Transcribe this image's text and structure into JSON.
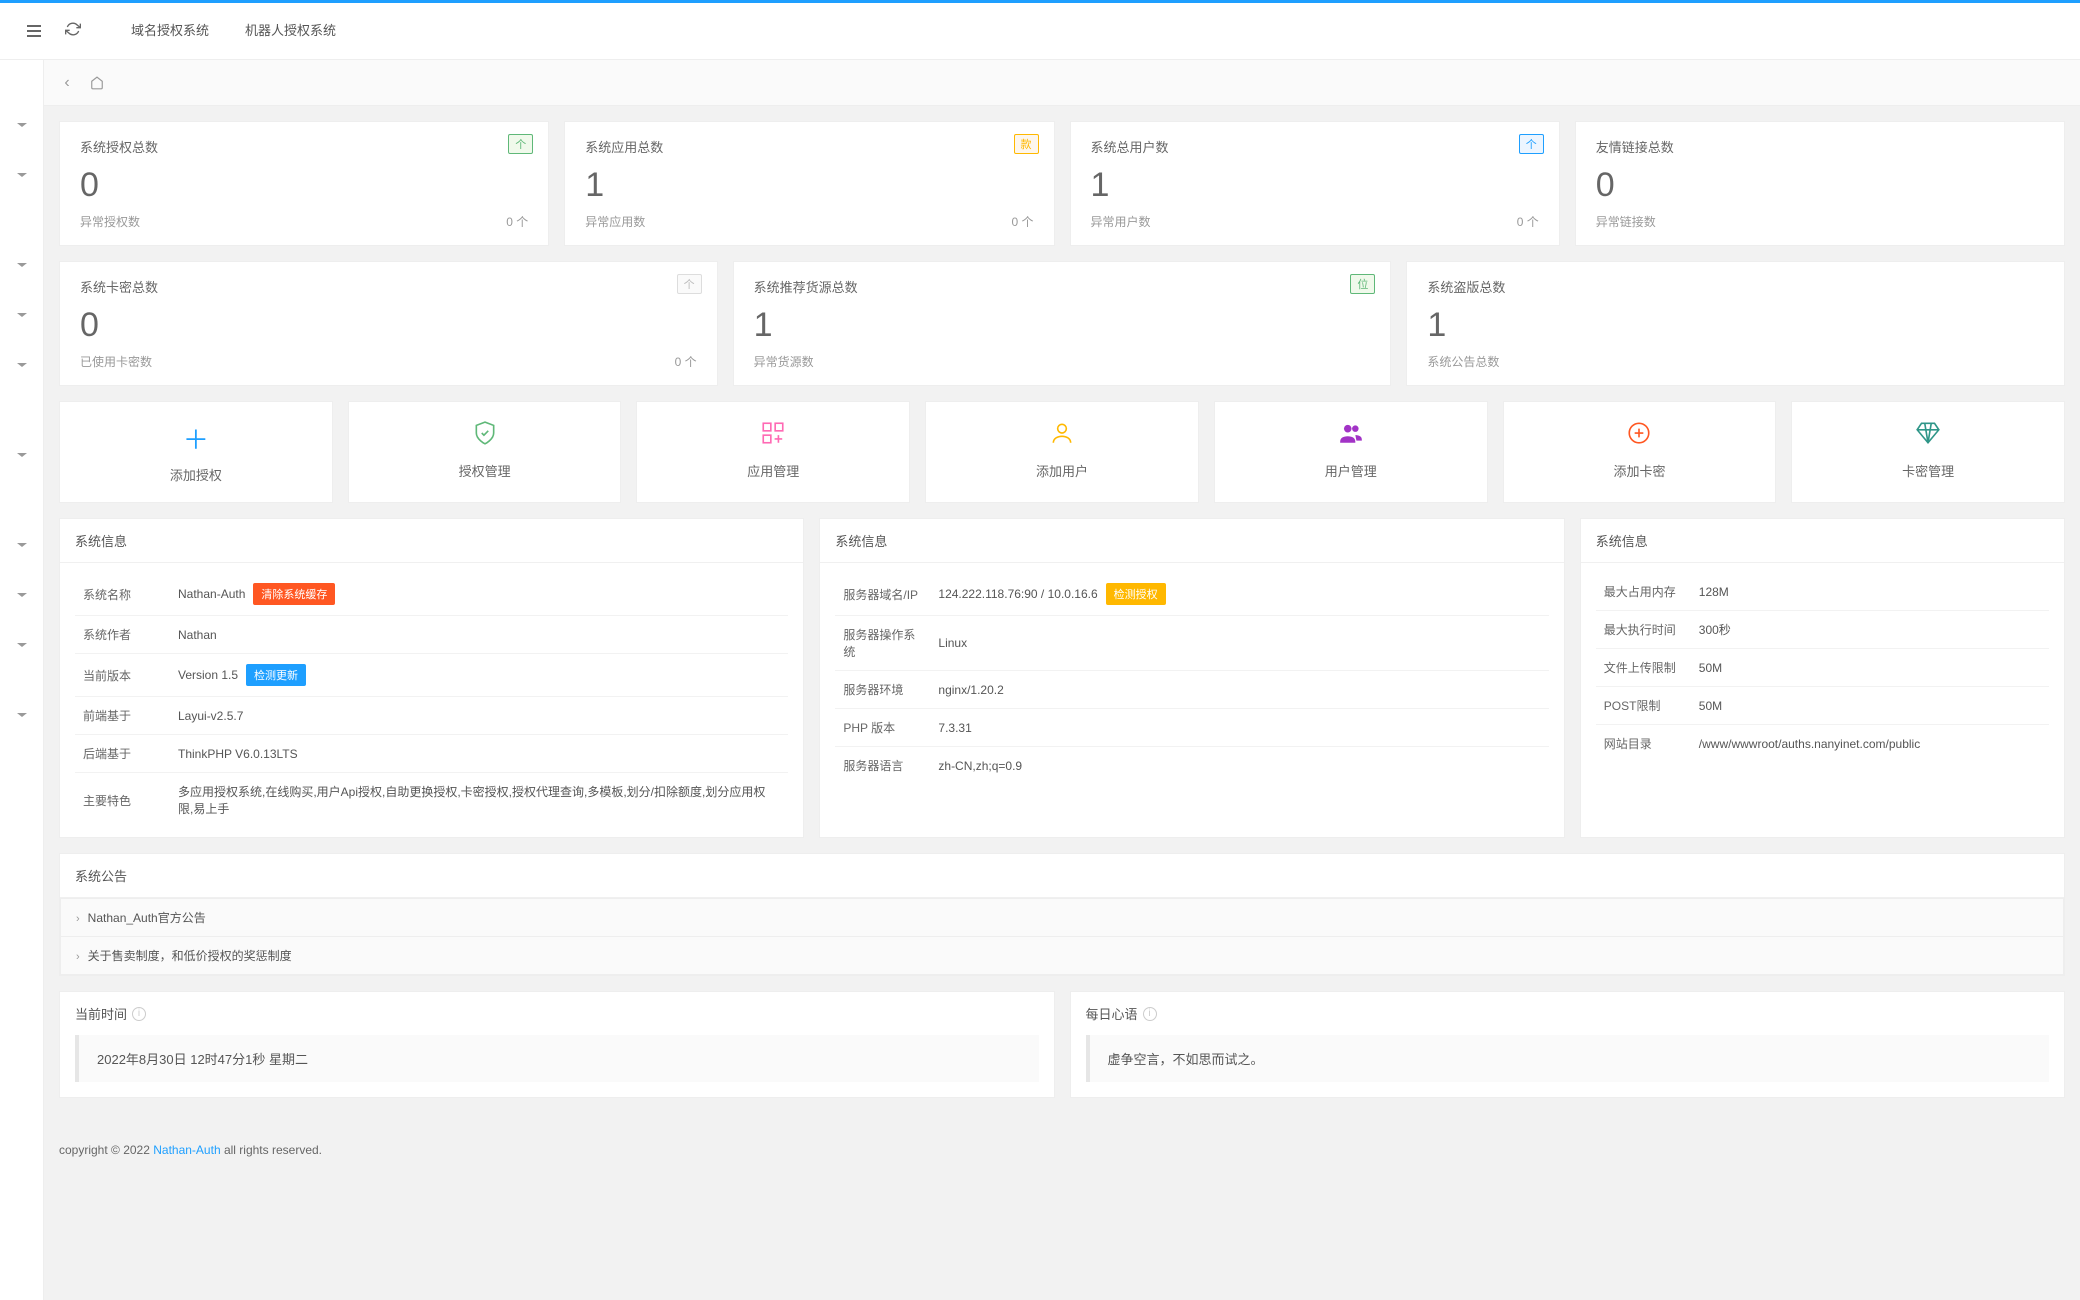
{
  "topbar": {
    "tabs": [
      "域名授权系统",
      "机器人授权系统"
    ]
  },
  "stats_row1": [
    {
      "title": "系统授权总数",
      "value": "0",
      "footer_label": "异常授权数",
      "footer_value": "0 个",
      "badge": "个",
      "badge_class": "badge-green"
    },
    {
      "title": "系统应用总数",
      "value": "1",
      "footer_label": "异常应用数",
      "footer_value": "0 个",
      "badge": "款",
      "badge_class": "badge-orange"
    },
    {
      "title": "系统总用户数",
      "value": "1",
      "footer_label": "异常用户数",
      "footer_value": "0 个",
      "badge": "个",
      "badge_class": "badge-blue"
    },
    {
      "title": "友情链接总数",
      "value": "0",
      "footer_label": "异常链接数",
      "footer_value": "",
      "badge": "",
      "badge_class": ""
    }
  ],
  "stats_row2": [
    {
      "title": "系统卡密总数",
      "value": "0",
      "footer_label": "已使用卡密数",
      "footer_value": "0 个",
      "badge": "个",
      "badge_class": "badge-gray"
    },
    {
      "title": "系统推荐货源总数",
      "value": "1",
      "footer_label": "异常货源数",
      "footer_value": "",
      "badge": "位",
      "badge_class": "badge-green"
    },
    {
      "title": "系统盗版总数",
      "value": "1",
      "footer_label": "系统公告总数",
      "footer_value": "",
      "badge": "",
      "badge_class": ""
    }
  ],
  "quick": [
    {
      "label": "添加授权",
      "icon": "＋",
      "color": "c-blue"
    },
    {
      "label": "授权管理",
      "icon": "shield",
      "color": "c-green"
    },
    {
      "label": "应用管理",
      "icon": "grid",
      "color": "c-rose"
    },
    {
      "label": "添加用户",
      "icon": "user",
      "color": "c-orange"
    },
    {
      "label": "用户管理",
      "icon": "users",
      "color": "c-purple"
    },
    {
      "label": "添加卡密",
      "icon": "plus-circle",
      "color": "c-red"
    },
    {
      "label": "卡密管理",
      "icon": "diamond",
      "color": "c-teal"
    }
  ],
  "sysinfo_title": "系统信息",
  "sysinfo_left": [
    {
      "k": "系统名称",
      "v": "Nathan-Auth",
      "btn": "清除系统缓存",
      "btn_class": "btn-orange"
    },
    {
      "k": "系统作者",
      "v": "Nathan"
    },
    {
      "k": "当前版本",
      "v": "Version 1.5",
      "btn": "检测更新",
      "btn_class": "btn-blue"
    },
    {
      "k": "前端基于",
      "v": "Layui-v2.5.7"
    },
    {
      "k": "后端基于",
      "v": "ThinkPHP V6.0.13LTS"
    },
    {
      "k": "主要特色",
      "v": "多应用授权系统,在线购买,用户Api授权,自助更换授权,卡密授权,授权代理查询,多模板,划分/扣除额度,划分应用权限,易上手"
    }
  ],
  "sysinfo_mid": [
    {
      "k": "服务器域名/IP",
      "v": "124.222.118.76:90 / 10.0.16.6",
      "btn": "检测授权",
      "btn_class": "btn-warn"
    },
    {
      "k": "服务器操作系统",
      "v": "Linux"
    },
    {
      "k": "服务器环境",
      "v": "nginx/1.20.2"
    },
    {
      "k": "PHP 版本",
      "v": "7.3.31"
    },
    {
      "k": "服务器语言",
      "v": "zh-CN,zh;q=0.9"
    }
  ],
  "sysinfo_right": [
    {
      "k": "最大占用内存",
      "v": "128M"
    },
    {
      "k": "最大执行时间",
      "v": "300秒"
    },
    {
      "k": "文件上传限制",
      "v": "50M"
    },
    {
      "k": "POST限制",
      "v": "50M"
    },
    {
      "k": "网站目录",
      "v": "/www/wwwroot/auths.nanyinet.com/public"
    }
  ],
  "notice_title": "系统公告",
  "notices": [
    "Nathan_Auth官方公告",
    "关于售卖制度，和低价授权的奖惩制度"
  ],
  "time_title": "当前时间",
  "time_value": "2022年8月30日 12时47分1秒 星期二",
  "quote_title": "每日心语",
  "quote_value": "虚争空言，不如思而试之。",
  "footer": {
    "prefix": "copyright © 2022 ",
    "link": "Nathan-Auth",
    "suffix": " all rights reserved."
  }
}
